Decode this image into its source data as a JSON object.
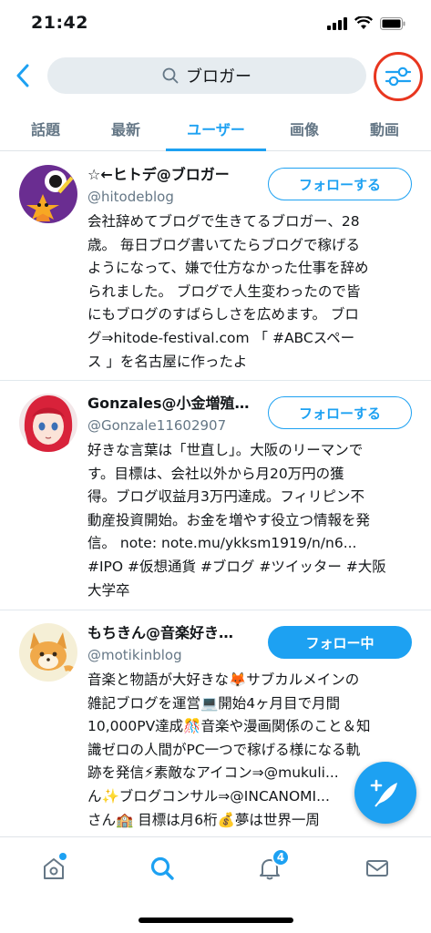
{
  "status_bar": {
    "time": "21:42"
  },
  "search": {
    "query": "ブロガー"
  },
  "tabs": [
    {
      "label": "話題"
    },
    {
      "label": "最新"
    },
    {
      "label": "ユーザー"
    },
    {
      "label": "画像"
    },
    {
      "label": "動画"
    }
  ],
  "active_tab": "ユーザー",
  "users": [
    {
      "name": "☆←ヒトデ@ブロガー",
      "handle": "@hitodeblog",
      "follow_label": "フォローする",
      "following": false,
      "bio": "会社辞めてブログで生きてるブロガー、28\n歳。 毎日ブログ書いてたらブログで稼げる\nようになって、嫌で仕方なかった仕事を辞め\nられました。 ブログで人生変わったので皆\nにもブログのすばらしさを広めます。 ブロ\nグ⇒hitode-festival.com 「 #ABCスペー\nス 」を名古屋に作ったよ"
    },
    {
      "name": "Gonzales@小金増殖…",
      "handle": "@Gonzale11602907",
      "follow_label": "フォローする",
      "following": false,
      "bio": "好きな言葉は「世直し」。大阪のリーマンで\nす。目標は、会社以外から月20万円の獲\n得。ブログ収益月3万円達成。フィリピン不\n動産投資開始。お金を増やす役立つ情報を発\n信。 note: note.mu/ykksm1919/n/n6...\n#IPO #仮想通貨 #ブログ #ツイッター #大阪\n大学卒"
    },
    {
      "name": "もちきん@音楽好き…",
      "handle": "@motikinblog",
      "follow_label": "フォロー中",
      "following": true,
      "bio": "音楽と物語が大好きな🦊サブカルメインの\n雑記ブログを運営💻開始4ヶ月目で月間\n10,000PV達成🎊音楽や漫画関係のこと＆知\n識ゼロの人間がPC一つで稼げる様になる軌\n跡を発信⚡素敵なアイコン⇒@mukuli...\nん✨ブログコンサル⇒@INCANOMI...\nさん🏫 目標は月6桁💰夢は世界一周"
    }
  ],
  "notifications_badge": "4",
  "colors": {
    "accent": "#1da1f2",
    "highlight_circle": "#e8361f",
    "secondary_text": "#657786",
    "search_bg": "#e6ecf0"
  },
  "icons": {
    "back": "chevron-left-icon",
    "search": "search-icon",
    "filter": "sliders-icon",
    "compose": "feather-plus-icon",
    "home": "home-icon",
    "explore": "search-icon",
    "notifications": "bell-icon",
    "messages": "envelope-icon"
  }
}
